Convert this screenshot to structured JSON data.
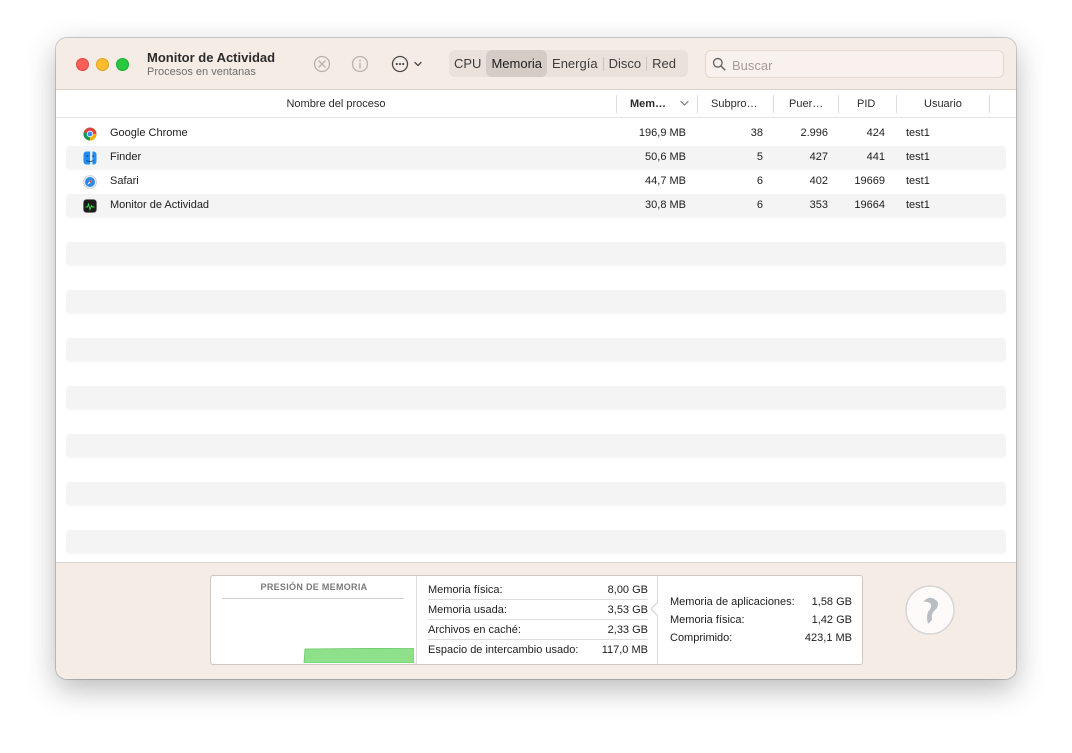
{
  "window": {
    "title": "Monitor de Actividad",
    "subtitle": "Procesos en ventanas"
  },
  "toolbar": {
    "stop_icon": "stop-process-icon",
    "info_icon": "info-icon",
    "more_icon": "ellipsis-menu-icon",
    "tabs": [
      {
        "label": "CPU",
        "active": false
      },
      {
        "label": "Memoria",
        "active": true
      },
      {
        "label": "Energía",
        "active": false
      },
      {
        "label": "Disco",
        "active": false
      },
      {
        "label": "Red",
        "active": false
      }
    ],
    "search_placeholder": "Buscar",
    "search_value": ""
  },
  "table": {
    "columns": {
      "name": "Nombre del proceso",
      "memory": "Mem…",
      "threads": "Subpro…",
      "ports": "Puer…",
      "pid": "PID",
      "user": "Usuario"
    },
    "sort_column": "memory",
    "sort_direction": "descending",
    "rows": [
      {
        "icon": "chrome-icon",
        "name": "Google Chrome",
        "memory": "196,9 MB",
        "threads": "38",
        "ports": "2.996",
        "pid": "424",
        "user": "test1"
      },
      {
        "icon": "finder-icon",
        "name": "Finder",
        "memory": "50,6 MB",
        "threads": "5",
        "ports": "427",
        "pid": "441",
        "user": "test1"
      },
      {
        "icon": "safari-icon",
        "name": "Safari",
        "memory": "44,7 MB",
        "threads": "6",
        "ports": "402",
        "pid": "19669",
        "user": "test1"
      },
      {
        "icon": "activity-monitor-icon",
        "name": "Monitor de Actividad",
        "memory": "30,8 MB",
        "threads": "6",
        "ports": "353",
        "pid": "19664",
        "user": "test1"
      }
    ]
  },
  "footer": {
    "pressure_label": "PRESIÓN DE MEMORIA",
    "pressure_color": "#8ee08a",
    "stats": [
      {
        "label": "Memoria física:",
        "value": "8,00 GB"
      },
      {
        "label": "Memoria usada:",
        "value": "3,53 GB"
      },
      {
        "label": "Archivos en caché:",
        "value": "2,33 GB"
      },
      {
        "label": "Espacio de intercambio usado:",
        "value": "117,0 MB"
      }
    ],
    "details": [
      {
        "label": "Memoria de aplicaciones:",
        "value": "1,58 GB"
      },
      {
        "label": "Memoria física:",
        "value": "1,42 GB"
      },
      {
        "label": "Comprimido:",
        "value": "423,1 MB"
      }
    ]
  },
  "colors": {
    "toolbar_bg": "#f6ece6",
    "close": "#fe5f57",
    "minimize": "#febc2e",
    "maximize": "#28c840"
  }
}
